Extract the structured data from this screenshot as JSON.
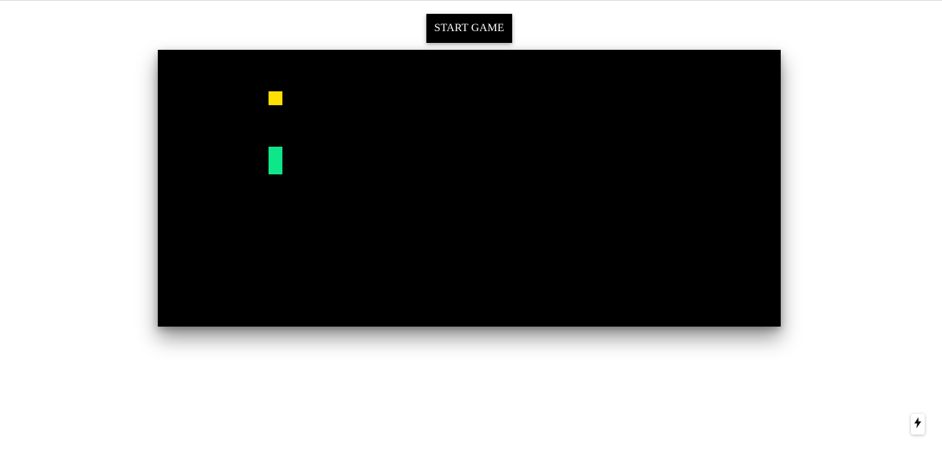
{
  "controls": {
    "start_label": "START GAME"
  },
  "board": {
    "background": "#000000",
    "grid": {
      "cols": 45,
      "rows": 20
    },
    "food": {
      "color": "#ffe000",
      "cell": [
        8,
        3
      ]
    },
    "snake": {
      "color": "#0ee68a",
      "cells": [
        [
          8,
          7
        ],
        [
          8,
          8
        ]
      ]
    }
  },
  "corner_button": {
    "icon": "lightning-bolt-icon"
  }
}
